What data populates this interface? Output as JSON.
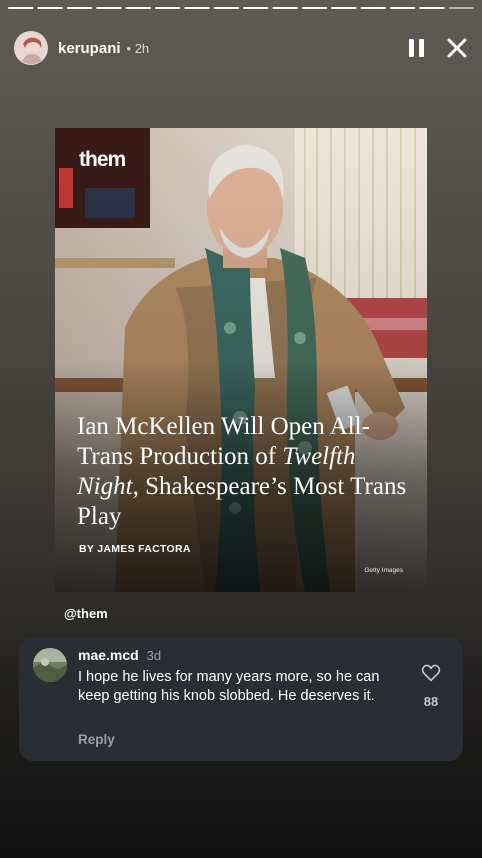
{
  "story": {
    "segment_count": 16,
    "active_segment": 16,
    "username": "kerupani",
    "time": "• 2h"
  },
  "post": {
    "brand": "them",
    "headline_part1": "Ian McKellen Will Open All-Trans Production of ",
    "headline_italic": "Twelfth Night",
    "headline_part2": ", Shakespeare’s Most Trans Play",
    "byline": "BY JAMES FACTORA",
    "credit": "Getty Images",
    "mention": "@them"
  },
  "comment": {
    "username": "mae.mcd",
    "time": "3d",
    "text": "I hope he lives for many years more, so he can keep getting his knob slobbed. He deserves it.",
    "reply_label": "Reply",
    "likes": "88"
  },
  "icons": {
    "pause": "pause-icon",
    "close": "close-icon",
    "heart": "heart-outline-icon"
  },
  "colors": {
    "comment_bg": "#2a2d31",
    "muted_text": "#9aa0a6"
  }
}
